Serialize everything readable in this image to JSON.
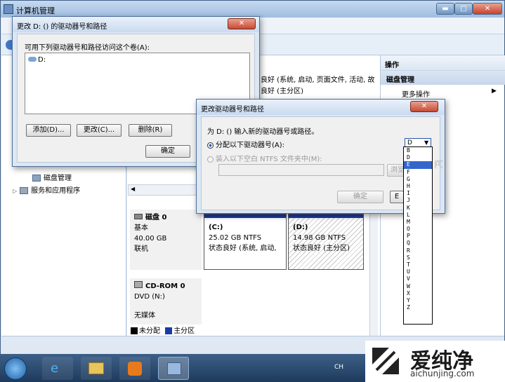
{
  "main": {
    "title": "计算机管理",
    "min_label": "▬",
    "max_label": "□",
    "close_label": "✕"
  },
  "nav": {
    "disk_mgmt": "磁盘管理",
    "services": "服务和应用程序"
  },
  "volumes": {
    "row1": "良好 (系统, 启动, 页面文件, 活动, 故",
    "row2": "良好 (主分区)"
  },
  "actions": {
    "header": "操作",
    "item1": "磁盘管理",
    "item2": "更多操作"
  },
  "disk0": {
    "name": "磁盘 0",
    "type": "基本",
    "size": "40.00 GB",
    "status": "联机",
    "part_c": {
      "label": "(C:)",
      "size": "25.02 GB NTFS",
      "status": "状态良好 (系统, 启动,"
    },
    "part_d": {
      "label": "(D:)",
      "size": "14.98 GB NTFS",
      "status": "状态良好 (主分区)"
    }
  },
  "cdrom": {
    "name": "CD-ROM 0",
    "drive": "DVD (N:)",
    "media": "无媒体"
  },
  "legend": {
    "unallocated": "未分配",
    "primary": "主分区"
  },
  "dialog1": {
    "title": "更改 D: () 的驱动器号和路径",
    "close_label": "✕",
    "prompt": "可用下列驱动器号和路径访问这个卷(A):",
    "list_item": "D:",
    "add": "添加(D)...",
    "change": "更改(C)...",
    "delete": "删除(R)",
    "ok": "确定"
  },
  "dialog2": {
    "title": "更改驱动器号和路径",
    "close_label": "✕",
    "prompt": "为 D: () 输入新的驱动器号或路径。",
    "radio1": "分配以下驱动器号(A):",
    "radio2": "装入以下空白 NTFS 文件夹中(M):",
    "browse": "浏览",
    "ok": "确定",
    "cancel_partial": "E",
    "selected_letter": "D",
    "letters": [
      "B",
      "D",
      "E",
      "F",
      "G",
      "H",
      "I",
      "J",
      "K",
      "L",
      "M",
      "O",
      "P",
      "Q",
      "R",
      "S",
      "T",
      "U",
      "V",
      "W",
      "X",
      "Y",
      "Z"
    ],
    "highlighted_index": 2
  },
  "taskbar": {
    "lang": "CH"
  },
  "watermark": {
    "brand": "爱纯净",
    "url": "aichunjing.com"
  },
  "colors": {
    "primary_partition": "#1a3aa8",
    "unallocated": "#000000",
    "selection": "#3366cc"
  }
}
